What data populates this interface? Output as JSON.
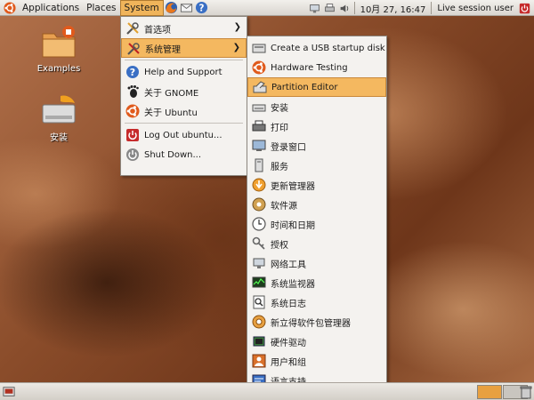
{
  "top_panel": {
    "applications": "Applications",
    "places": "Places",
    "system": "System",
    "clock": "10月 27, 16:47",
    "session": "Live session user"
  },
  "desktop_icons": [
    {
      "label": "Examples",
      "icon": "folder-icon"
    },
    {
      "label": "安装",
      "icon": "installer-icon"
    }
  ],
  "system_menu": {
    "items": [
      {
        "label": "首选项",
        "icon": "preferences-icon",
        "submenu": true
      },
      {
        "label": "系统管理",
        "icon": "administration-icon",
        "submenu": true,
        "highlighted": true
      },
      {
        "label": "Help and Support",
        "icon": "help-icon"
      },
      {
        "label": "关于 GNOME",
        "icon": "gnome-foot-icon"
      },
      {
        "label": "关于 Ubuntu",
        "icon": "ubuntu-icon"
      },
      {
        "label": "Log Out ubuntu...",
        "icon": "logout-icon"
      },
      {
        "label": "Shut Down...",
        "icon": "shutdown-icon"
      }
    ]
  },
  "admin_menu": {
    "items": [
      {
        "label": "Create a USB startup disk",
        "icon": "usb-disk-icon"
      },
      {
        "label": "Hardware Testing",
        "icon": "hardware-testing-icon"
      },
      {
        "label": "Partition Editor",
        "icon": "partition-editor-icon",
        "highlighted": true
      },
      {
        "label": "安装",
        "icon": "install-icon"
      },
      {
        "label": "打印",
        "icon": "printer-icon"
      },
      {
        "label": "登录窗口",
        "icon": "login-window-icon"
      },
      {
        "label": "服务",
        "icon": "services-icon"
      },
      {
        "label": "更新管理器",
        "icon": "update-manager-icon"
      },
      {
        "label": "软件源",
        "icon": "software-sources-icon"
      },
      {
        "label": "时间和日期",
        "icon": "clock-icon"
      },
      {
        "label": "授权",
        "icon": "keys-icon"
      },
      {
        "label": "网络工具",
        "icon": "network-tools-icon"
      },
      {
        "label": "系统监视器",
        "icon": "system-monitor-icon"
      },
      {
        "label": "系统日志",
        "icon": "system-log-icon"
      },
      {
        "label": "新立得软件包管理器",
        "icon": "synaptic-icon"
      },
      {
        "label": "硬件驱动",
        "icon": "hardware-drivers-icon"
      },
      {
        "label": "用户和组",
        "icon": "users-groups-icon"
      },
      {
        "label": "语言支持",
        "icon": "language-support-icon"
      }
    ]
  },
  "colors": {
    "highlight": "#f4b860",
    "panel": "#e6e3de",
    "ubuntu_orange": "#e05a1c"
  }
}
